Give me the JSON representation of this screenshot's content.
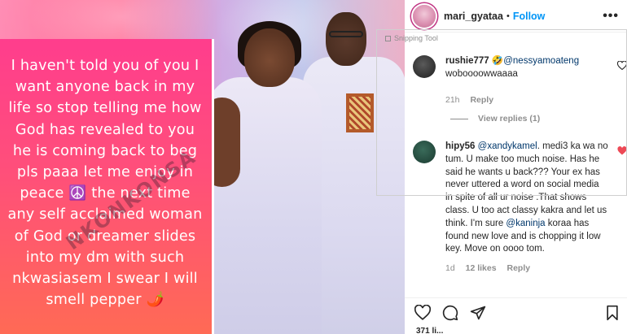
{
  "post": {
    "card_text": "I haven't told you of you I want anyone back in my life so stop telling me how God has revealed to you he is coming back to beg pls paaa let me enjoy in peace ☮️ the next time any self acclaimed woman of God or dreamer slides into my dm with such nkwasiasem I swear I will smell pepper 🌶️",
    "watermark": "NKONKONSA"
  },
  "header": {
    "username": "mari_gyataa",
    "dot": "•",
    "follow_label": "Follow",
    "more_icon": "more-options-icon"
  },
  "snipping_tool": {
    "label": "Snipping Tool"
  },
  "comments": [
    {
      "username": "rushie777",
      "mention_emoji": "🤣",
      "mention": "@nessyamoateng",
      "text": "woboooowwaaaa",
      "time": "21h",
      "reply_label": "Reply",
      "liked": false
    },
    {
      "username": "hipy56",
      "mention": "@xandykamel",
      "text_1": ". medi3 ka wa no tum. U make too much noise. Has he said he wants u back??? Your ex has never uttered a word on social media in spite of all ur noise .That shows class. U too act classy kakra and let us think. I'm sure",
      "mention_2": "@kaninja",
      "text_2": " koraa has found new love and is chopping it low key. Move on oooo tom.",
      "time": "1d",
      "likes": "12 likes",
      "reply_label": "Reply",
      "liked": true
    }
  ],
  "view_replies": "View replies (1)",
  "actions": {
    "like_icon": "heart-icon",
    "comment_icon": "comment-icon",
    "share_icon": "share-icon",
    "save_icon": "bookmark-icon"
  },
  "likes_peek": "371 li...",
  "colors": {
    "follow": "#0095f6",
    "heart_liked": "#ed4956",
    "mention": "#00376b"
  }
}
